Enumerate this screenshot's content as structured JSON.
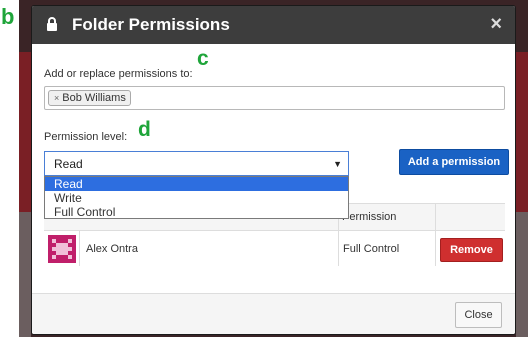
{
  "callouts": {
    "b": "b",
    "c": "c",
    "d": "d"
  },
  "dialog": {
    "title": "Folder Permissions",
    "close_symbol": "×",
    "lock_icon": "lock-icon"
  },
  "form": {
    "add_label": "Add or replace permissions to:",
    "tags": [
      {
        "remove_symbol": "×",
        "name": "Bob Williams"
      }
    ],
    "permission_level_label": "Permission level:",
    "permission_select": {
      "value": "Read",
      "arrow": "▼",
      "options": [
        "Read",
        "Write",
        "Full Control"
      ],
      "highlighted_option": "Read"
    },
    "add_button_label": "Add a permission"
  },
  "table": {
    "header_permission": "Permission",
    "rows": [
      {
        "avatar_icon": "pixel-avatar-icon",
        "user": "Alex Ontra",
        "permission": "Full Control",
        "remove_label": "Remove"
      }
    ]
  },
  "footer": {
    "close_label": "Close"
  },
  "colors": {
    "header_bg": "#3d3d3d",
    "primary": "#1a62c4",
    "danger": "#cf2f2f",
    "callout": "#1fa53a",
    "highlight": "#2d6ee0"
  }
}
